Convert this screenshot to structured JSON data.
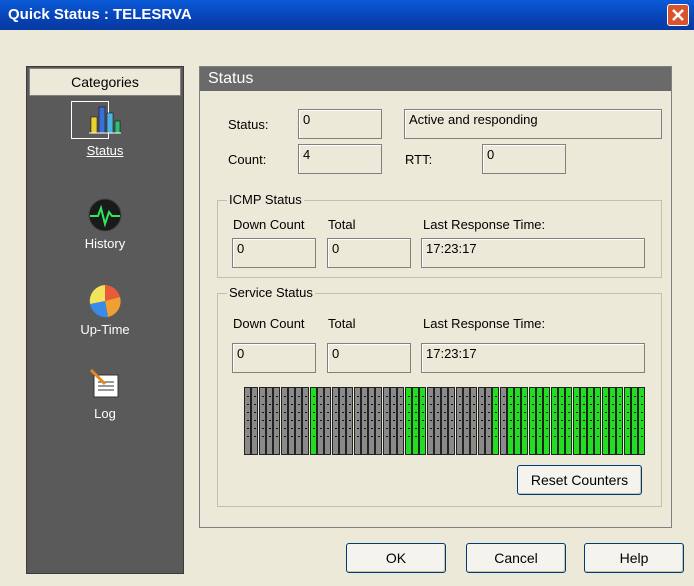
{
  "window": {
    "title": "Quick Status : TELESRVA"
  },
  "sidebar": {
    "header": "Categories",
    "items": [
      {
        "label": "Status",
        "icon": "bar-chart-icon",
        "selected": true
      },
      {
        "label": "History",
        "icon": "heartbeat-icon",
        "selected": false
      },
      {
        "label": "Up-Time",
        "icon": "pie-chart-icon",
        "selected": false
      },
      {
        "label": "Log",
        "icon": "log-notepad-icon",
        "selected": false
      }
    ]
  },
  "status": {
    "header": "Status",
    "status_label": "Status:",
    "status_value": "0",
    "status_text": "Active and responding",
    "count_label": "Count:",
    "count_value": "4",
    "rtt_label": "RTT:",
    "rtt_value": "0"
  },
  "icmp": {
    "title": "ICMP Status",
    "down_count_label": "Down Count",
    "total_label": "Total",
    "last_response_label": "Last Response Time:",
    "down_count": "0",
    "total": "0",
    "last_response": "17:23:17"
  },
  "service": {
    "title": "Service Status",
    "down_count_label": "Down Count",
    "total_label": "Total",
    "last_response_label": "Last Response Time:",
    "down_count": "0",
    "total": "0",
    "last_response": "17:23:17",
    "history_bars": [
      "gray",
      "gray",
      "gray",
      "gray",
      "gray",
      "gray",
      "gray",
      "gray",
      "gray",
      "green",
      "gray",
      "gray",
      "gray",
      "gray",
      "gray",
      "gray",
      "gray",
      "gray",
      "gray",
      "gray",
      "gray",
      "gray",
      "green",
      "green",
      "green",
      "gray",
      "gray",
      "gray",
      "gray",
      "gray",
      "gray",
      "gray",
      "gray",
      "gray",
      "green",
      "gray",
      "green",
      "green",
      "green",
      "green",
      "green",
      "green",
      "green",
      "green",
      "green",
      "green",
      "green",
      "green",
      "green",
      "green",
      "green",
      "green",
      "green",
      "green",
      "green"
    ],
    "reset_label": "Reset Counters"
  },
  "buttons": {
    "ok": "OK",
    "cancel": "Cancel",
    "help": "Help"
  },
  "colors": {
    "titlebar": "#0842b6",
    "sidebar": "#5a5a5a",
    "panel_header": "#6a6a6a",
    "bar_up": "#22dd22",
    "bar_down": "#8a8a8a"
  }
}
